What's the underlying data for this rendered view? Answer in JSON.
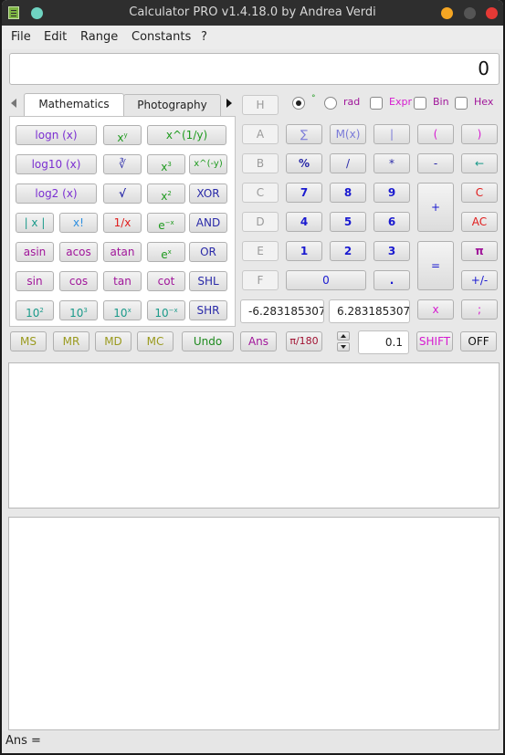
{
  "window": {
    "title": "Calculator PRO v1.4.18.0 by Andrea Verdi"
  },
  "menu": [
    "File",
    "Edit",
    "Range",
    "Constants",
    "?"
  ],
  "display": {
    "value": "0"
  },
  "tabs": [
    {
      "label": "Mathematics",
      "active": true
    },
    {
      "label": "Photography",
      "active": false
    }
  ],
  "math_buttons": {
    "logn": "logn (x)",
    "xy": "x",
    "xy_sup": "y",
    "xroot": "x^(1/y)",
    "log10": "log10 (x)",
    "cbrt": "∛",
    "x3": "x",
    "x3_sup": "3",
    "xneg": "x^(-y)",
    "log2": "log2 (x)",
    "sqrt": "√",
    "x2": "x",
    "x2_sup": "2",
    "xor": "XOR",
    "abs": "| x |",
    "fact": "x!",
    "recip": "1/x",
    "enegx": "e",
    "enegx_sup": "−x",
    "and": "AND",
    "asin": "asin",
    "acos": "acos",
    "atan": "atan",
    "ex": "e",
    "ex_sup": "x",
    "or": "OR",
    "sin": "sin",
    "cos": "cos",
    "tan": "tan",
    "cot": "cot",
    "shl": "SHL",
    "p10_2": "10",
    "p10_2_sup": "2",
    "p10_3": "10",
    "p10_3_sup": "3",
    "p10_x": "10",
    "p10_x_sup": "x",
    "p10_negx": "10",
    "p10_negx_sup": "−x",
    "shr": "SHR"
  },
  "memory_buttons": {
    "ms": "MS",
    "mr": "MR",
    "md": "MD",
    "mc": "MC",
    "undo": "Undo",
    "ans": "Ans",
    "pi180": "π/180",
    "shift": "SHIFT",
    "off": "OFF"
  },
  "angle_mode": {
    "degree_label": "°",
    "radian_label": "rad",
    "selected": "degree"
  },
  "options": {
    "expr": {
      "label": "Expr",
      "checked": false
    },
    "bin": {
      "label": "Bin",
      "checked": false
    },
    "hex": {
      "label": "Hex",
      "checked": false
    }
  },
  "hex_digits": [
    "H",
    "A",
    "B",
    "C",
    "D",
    "E",
    "F"
  ],
  "keypad": {
    "sum": "∑",
    "mx": "M(x)",
    "pipe": "|",
    "lparen": "(",
    "rparen": ")",
    "percent": "%",
    "divide": "/",
    "multiply": "*",
    "minus": "-",
    "backspace": "←",
    "d7": "7",
    "d8": "8",
    "d9": "9",
    "plus": "+",
    "clear": "C",
    "d4": "4",
    "d5": "5",
    "d6": "6",
    "allclear": "AC",
    "d1": "1",
    "d2": "2",
    "d3": "3",
    "equals": "=",
    "pi": "π",
    "d0": "0",
    "dot": ".",
    "sign": "+/-",
    "x": "x",
    "semicolon": ";"
  },
  "range": {
    "min": "-6.283185307",
    "max": "6.283185307:"
  },
  "step": {
    "value": "0.1"
  },
  "history_text": "",
  "output_text": "",
  "status": {
    "ans_label": "Ans ="
  }
}
